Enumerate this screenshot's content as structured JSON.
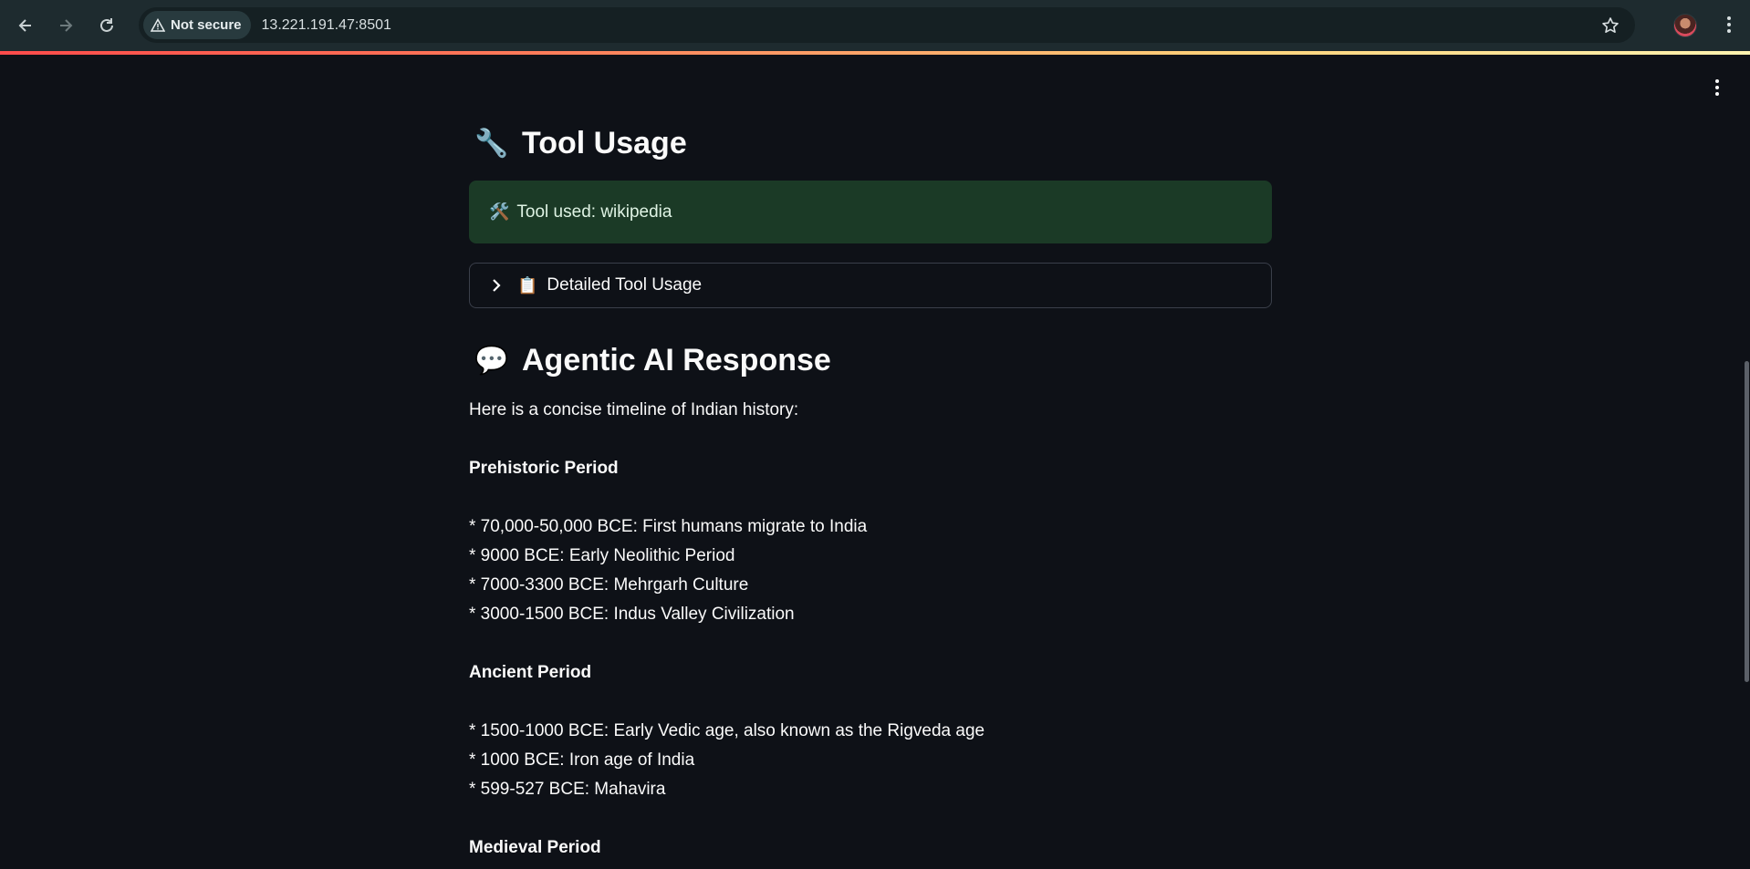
{
  "browser": {
    "security_label": "Not secure",
    "url": "13.221.191.47:8501"
  },
  "tool_section": {
    "heading_icon": "🔧",
    "heading": "Tool Usage",
    "alert_icon": "🛠️",
    "alert_text": "Tool used: wikipedia",
    "expander_icon": "📋",
    "expander_label": "Detailed Tool Usage"
  },
  "response_section": {
    "heading_icon": "💬",
    "heading": "Agentic AI Response",
    "intro": "Here is a concise timeline of Indian history:",
    "periods": [
      {
        "title": "Prehistoric Period",
        "items": [
          "* 70,000-50,000 BCE: First humans migrate to India",
          "* 9000 BCE: Early Neolithic Period",
          "* 7000-3300 BCE: Mehrgarh Culture",
          "* 3000-1500 BCE: Indus Valley Civilization"
        ]
      },
      {
        "title": "Ancient Period",
        "items": [
          "* 1500-1000 BCE: Early Vedic age, also known as the Rigveda age",
          "* 1000 BCE: Iron age of India",
          "* 599-527 BCE: Mahavira"
        ]
      },
      {
        "title": "Medieval Period",
        "items": []
      }
    ]
  }
}
